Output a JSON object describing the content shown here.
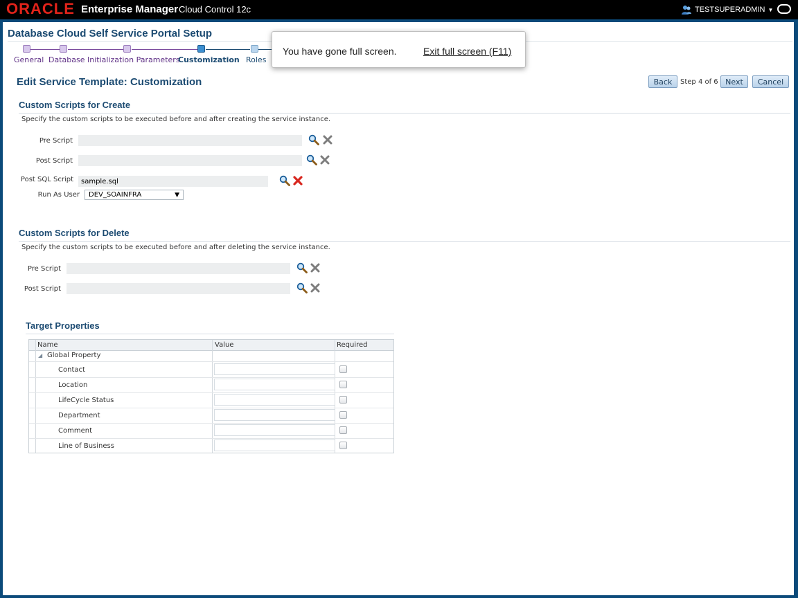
{
  "header": {
    "logo": "ORACLE",
    "product": "Enterprise Manager",
    "edition": "Cloud Control 12c",
    "user": "TESTSUPERADMIN"
  },
  "page_title": "Database Cloud Self Service Portal Setup",
  "train": {
    "steps": [
      {
        "label": "General",
        "state": "visited"
      },
      {
        "label": "Database",
        "state": "visited"
      },
      {
        "label": "Initialization Parameters",
        "state": "visited"
      },
      {
        "label": "Customization",
        "state": "current"
      },
      {
        "label": "Roles",
        "state": "future"
      }
    ]
  },
  "edit_title": "Edit Service Template: Customization",
  "nav": {
    "back": "Back",
    "step": "Step 4 of 6",
    "next": "Next",
    "cancel": "Cancel"
  },
  "create_section": {
    "title": "Custom Scripts for Create",
    "instruction": "Specify the custom scripts to be executed before and after creating the service instance.",
    "pre_script_label": "Pre Script",
    "pre_script_value": "",
    "post_script_label": "Post Script",
    "post_script_value": "",
    "post_sql_label": "Post SQL Script",
    "post_sql_value": "sample.sql",
    "run_as_label": "Run As User",
    "run_as_value": "DEV_SOAINFRA"
  },
  "delete_section": {
    "title": "Custom Scripts for Delete",
    "instruction": "Specify the custom scripts to be executed before and after deleting the service instance.",
    "pre_script_label": "Pre Script",
    "pre_script_value": "",
    "post_script_label": "Post Script",
    "post_script_value": ""
  },
  "target_properties": {
    "title": "Target Properties",
    "columns": {
      "name": "Name",
      "value": "Value",
      "required": "Required"
    },
    "group": "Global Property",
    "rows": [
      {
        "name": "Contact",
        "value": "",
        "required": false
      },
      {
        "name": "Location",
        "value": "",
        "required": false
      },
      {
        "name": "LifeCycle Status",
        "value": "",
        "required": false
      },
      {
        "name": "Department",
        "value": "",
        "required": false
      },
      {
        "name": "Comment",
        "value": "",
        "required": false
      },
      {
        "name": "Line of Business",
        "value": "",
        "required": false
      }
    ]
  },
  "fullscreen_toast": {
    "message": "You have gone full screen.",
    "exit_link": "Exit full screen (F11)"
  },
  "colors": {
    "brand_red": "#e2231a",
    "title_blue": "#1c4b72",
    "visited_purple": "#5e2f85",
    "frame_blue": "#0b4a7a"
  }
}
